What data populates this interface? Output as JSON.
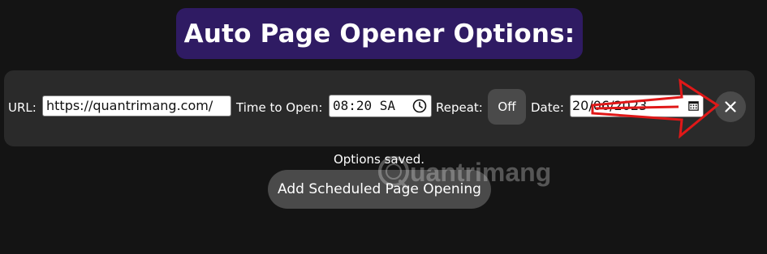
{
  "header": {
    "title": "Auto Page Opener Options:"
  },
  "form": {
    "url_label": "URL:",
    "url_value": "https://quantrimang.com/",
    "time_label": "Time to Open:",
    "time_value": "08:20 SA",
    "repeat_label": "Repeat:",
    "repeat_value": "Off",
    "date_label": "Date:",
    "date_value": "20/06/2023"
  },
  "status": {
    "message": "Options saved."
  },
  "actions": {
    "add_label": "Add Scheduled Page Opening"
  },
  "watermark": {
    "text": "uantrimang"
  },
  "colors": {
    "background": "#141414",
    "title_bg": "#2f1b63",
    "bar_bg": "#2a2a2a",
    "button_bg": "#4a4a4a",
    "annotation_red": "#e01818"
  }
}
